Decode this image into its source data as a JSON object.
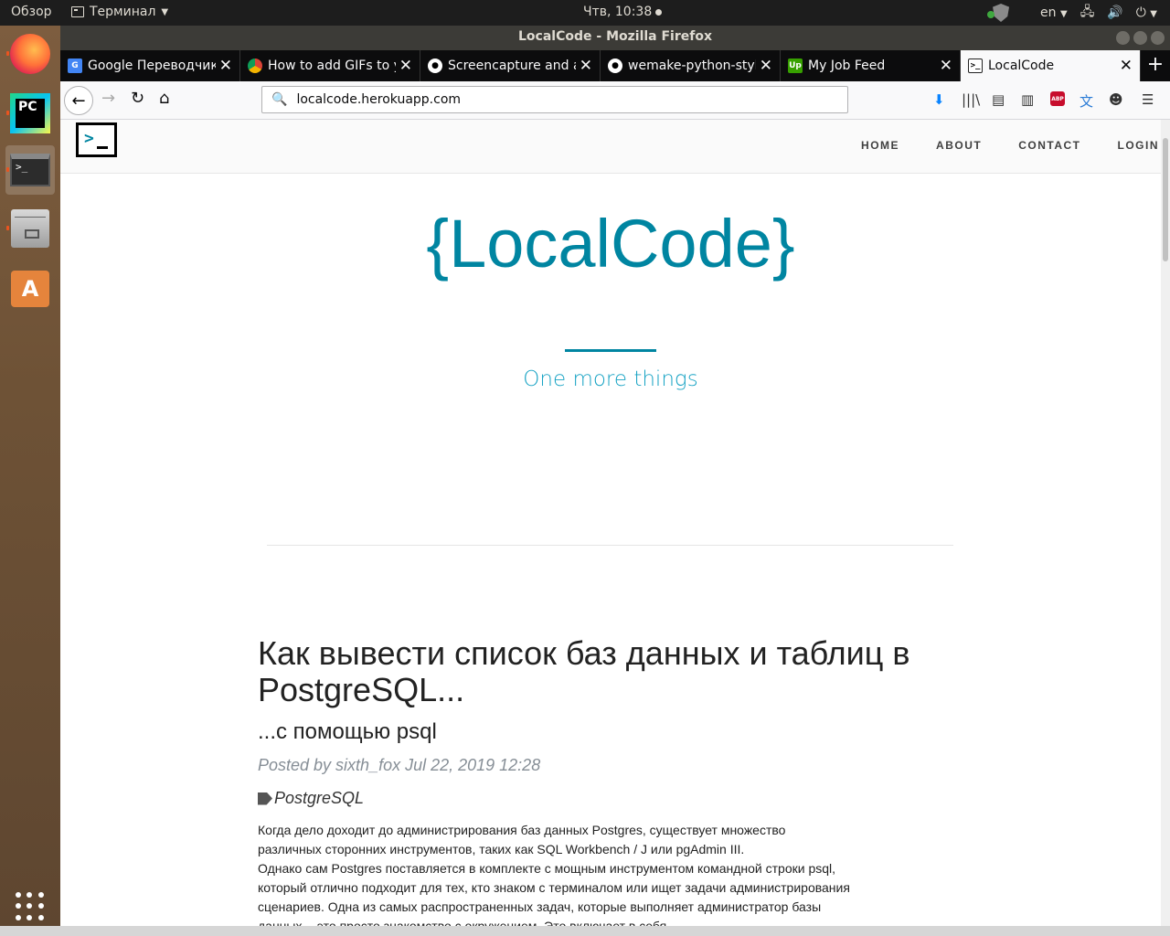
{
  "top_panel": {
    "overview": "Обзор",
    "app_name": "Терминал",
    "clock": "Чтв, 10:38",
    "lang": "en",
    "icons": [
      "shield-icon",
      "network-icon",
      "volume-icon",
      "power-icon"
    ]
  },
  "launcher": {
    "items": [
      "firefox-icon",
      "pycharm-icon",
      "terminal-icon",
      "files-icon",
      "software-center-icon"
    ],
    "pycharm_text": "PC",
    "terminal_text": ">_"
  },
  "window": {
    "title": "LocalCode - Mozilla Firefox"
  },
  "tabs": [
    {
      "label": "Google Переводчик",
      "favicon": "G"
    },
    {
      "label": "How to add GIFs to y",
      "favicon": ""
    },
    {
      "label": "Screencapture and a",
      "favicon": ""
    },
    {
      "label": "wemake-python-styl",
      "favicon": ""
    },
    {
      "label": "My Job Feed",
      "favicon": "Up"
    },
    {
      "label": "LocalCode",
      "favicon": ">_"
    }
  ],
  "navbar": {
    "url": "localcode.herokuapp.com"
  },
  "site": {
    "brand_glyph": ">",
    "menu": [
      "HOME",
      "ABOUT",
      "CONTACT",
      "LOGIN"
    ],
    "hero_title": "{LocalCode}",
    "hero_subtitle": "One more things",
    "post": {
      "title": "Как вывести список баз данных и таблиц в PostgreSQL...",
      "subtitle": "...с помощью psql",
      "meta": "Posted by sixth_fox Jul 22, 2019 12:28",
      "tag": "PostgreSQL",
      "body": [
        "Когда дело доходит до администрирования баз данных Postgres, существует множество различных сторонних инструментов, таких как SQL Workbench / J или pgAdmin III.",
        "Однако сам Postgres поставляется в комплекте с мощным инструментом командной строки psql, который отлично подходит для тех, кто знаком с терминалом или ищет задачи администрирования сценариев. Одна из самых распространенных задач, которые выполняет администратор базы данных, - это просто знакомство с окружением. Это включает в себя"
      ]
    }
  },
  "colors": {
    "accent": "#0085a1",
    "subtitle": "#18a3c4",
    "meta": "#868e96"
  }
}
